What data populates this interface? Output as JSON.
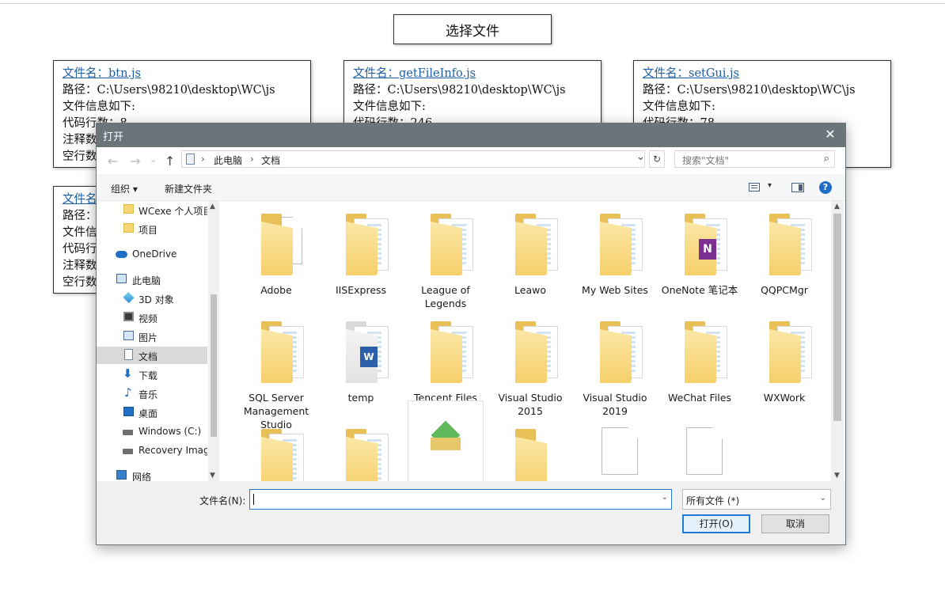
{
  "page": {
    "select_button": "选择文件",
    "cards": [
      {
        "name": "文件名：btn.js",
        "path": "路径：C:\\Users\\98210\\desktop\\WC\\js",
        "info": "文件信息如下:",
        "lines": [
          "代码行数：8",
          "注释数：",
          "空行数："
        ]
      },
      {
        "name": "文件名：getFileInfo.js",
        "path": "路径：C:\\Users\\98210\\desktop\\WC\\js",
        "info": "文件信息如下:",
        "lines": [
          "代码行数：246",
          "",
          ""
        ]
      },
      {
        "name": "文件名：setGui.js",
        "path": "路径：C:\\Users\\98210\\desktop\\WC\\js",
        "info": "文件信息如下:",
        "lines": [
          "代码行数：78",
          "",
          ""
        ]
      },
      {
        "name": "文件名",
        "path": "路径：",
        "info": "文件信",
        "lines": [
          "代码行",
          "注释数",
          "空行数"
        ]
      }
    ]
  },
  "dialog": {
    "title": "打开",
    "close": "✕",
    "nav": {
      "back": "←",
      "forward": "→",
      "up": "↑",
      "recent": "⌄"
    },
    "address": {
      "sep": "›",
      "crumbs": [
        "此电脑",
        "文档"
      ],
      "dropdown": "⌄",
      "refresh": "↻"
    },
    "search": {
      "placeholder": "搜索\"文档\"",
      "icon": "⌕"
    },
    "toolbar": {
      "organize": "组织 ▾",
      "new_folder": "新建文件夹",
      "view_dd": "▾",
      "help": "?"
    },
    "sidebar": [
      {
        "label": "WCexe 个人项目",
        "icon": "folder-icon"
      },
      {
        "label": "项目",
        "icon": "folder-icon"
      },
      {
        "label": "OneDrive",
        "icon": "cloud-icon"
      },
      {
        "label": "此电脑",
        "icon": "computer-icon"
      },
      {
        "label": "3D 对象",
        "icon": "cube-icon"
      },
      {
        "label": "视频",
        "icon": "video-icon"
      },
      {
        "label": "图片",
        "icon": "picture-icon"
      },
      {
        "label": "文档",
        "icon": "document-icon",
        "selected": true
      },
      {
        "label": "下载",
        "icon": "download-icon"
      },
      {
        "label": "音乐",
        "icon": "music-icon"
      },
      {
        "label": "桌面",
        "icon": "desktop-icon"
      },
      {
        "label": "Windows (C:)",
        "icon": "drive-icon"
      },
      {
        "label": "Recovery Imag",
        "icon": "drive-icon"
      },
      {
        "label": "网络",
        "icon": "network-icon"
      }
    ],
    "files": [
      {
        "label": "Adobe",
        "icon": "folder-icon"
      },
      {
        "label": "IISExpress",
        "icon": "folder-icon"
      },
      {
        "label": "League of Legends",
        "icon": "folder-icon"
      },
      {
        "label": "Leawo",
        "icon": "folder-icon"
      },
      {
        "label": "My Web Sites",
        "icon": "folder-icon"
      },
      {
        "label": "OneNote 笔记本",
        "icon": "onenote-folder-icon"
      },
      {
        "label": "QQPCMgr",
        "icon": "folder-icon"
      },
      {
        "label": "SQL Server Management Studio",
        "icon": "folder-icon"
      },
      {
        "label": "temp",
        "icon": "word-folder-icon"
      },
      {
        "label": "Tencent Files",
        "icon": "folder-icon"
      },
      {
        "label": "Visual Studio 2015",
        "icon": "folder-icon"
      },
      {
        "label": "Visual Studio 2019",
        "icon": "folder-icon"
      },
      {
        "label": "WeChat Files",
        "icon": "folder-icon"
      },
      {
        "label": "WXWork",
        "icon": "folder-icon"
      },
      {
        "label": "",
        "icon": "folder-icon"
      },
      {
        "label": "",
        "icon": "folder-icon"
      },
      {
        "label": "",
        "icon": "installer-icon"
      },
      {
        "label": "",
        "icon": "folder-icon"
      },
      {
        "label": "",
        "icon": "file-icon"
      },
      {
        "label": "",
        "icon": "file-icon"
      }
    ],
    "bottom": {
      "filename_label": "文件名(N):",
      "filename_value": "",
      "filter": "所有文件 (*)",
      "open": "打开(O)",
      "cancel": "取消"
    }
  }
}
